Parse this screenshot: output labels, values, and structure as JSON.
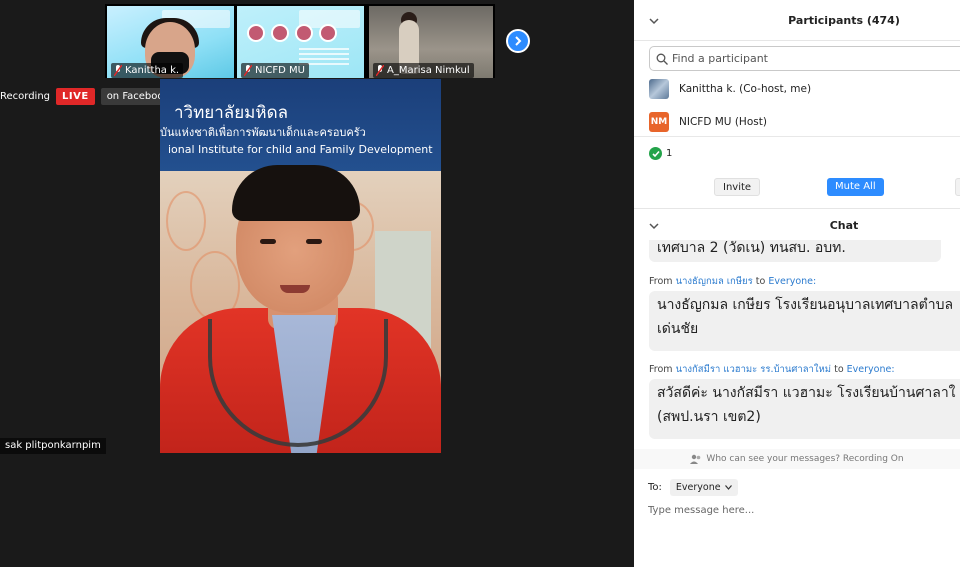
{
  "video": {
    "thumbnails": [
      {
        "name": "Kanittha k."
      },
      {
        "name": "NICFD MU"
      },
      {
        "name": "A_Marisa Nimkul"
      }
    ],
    "recording_label": "Recording",
    "live_badge": "LIVE",
    "stream_target": "on Facebook",
    "banner": {
      "line1": "าวิทยาลัยมหิดล",
      "line2": "บันแห่งชาติเพื่อการพัฒนาเด็กและครอบครัว",
      "line3": "ional Institute for child and Family Development"
    },
    "speaker_name": "sak plitponkarnpim"
  },
  "participants": {
    "title": "Participants (474)",
    "search_placeholder": "Find a participant",
    "list": [
      {
        "label": "Kanittha k. (Co-host, me)"
      },
      {
        "label": "NICFD MU (Host)",
        "initials": "NM"
      }
    ],
    "count_ok": "1",
    "invite_label": "Invite",
    "mute_all_label": "Mute All"
  },
  "chat": {
    "title": "Chat",
    "messages": [
      {
        "text": "เทศบาล 2 (วัดเน) ทนสบ. อบท."
      },
      {
        "from_prefix": "From",
        "sender": "นางธัญกมล  เกษียร",
        "to": "to",
        "target": "Everyone:",
        "text1": "นางธัญกมล  เกษียร โรงเรียนอนุบาลเทศบาลตำบล",
        "text2": "เด่นชัย"
      },
      {
        "from_prefix": "From",
        "sender": "นางกัสมีรา  แวฮามะ รร.บ้านศาลาใหม่",
        "to": "to",
        "target": "Everyone:",
        "text1": "สวัสดีค่ะ นางกัสมีรา  แวฮามะ โรงเรียนบ้านศาลาใ",
        "text2": "(สพป.นรา เขต2)"
      }
    ],
    "recording_note": "Who can see your messages? Recording On",
    "to_label": "To:",
    "to_value": "Everyone",
    "input_placeholder": "Type message here..."
  },
  "colors": {
    "accent": "#2d8cff",
    "live": "#e02828",
    "host_avatar": "#e8652b",
    "ok": "#23a34a"
  }
}
